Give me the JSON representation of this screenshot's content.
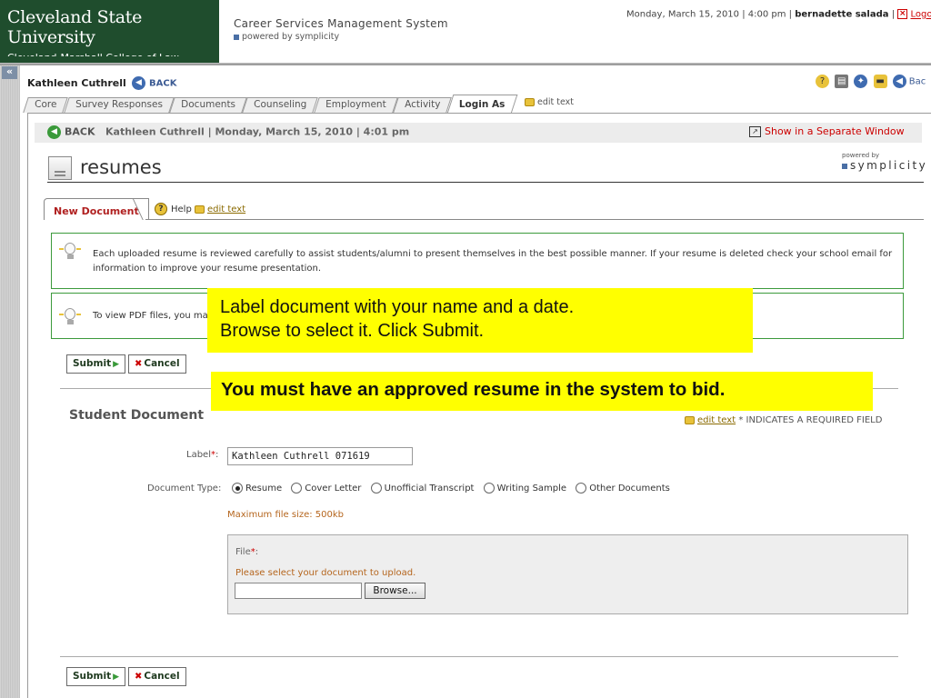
{
  "header": {
    "university": "Cleveland State University",
    "college": "Cleveland-Marshall College of Law",
    "system_title": "Career Services Management System",
    "powered_by": "powered by symplicity",
    "datetime": "Monday, March 15, 2010 | 4:00 pm |",
    "user": "bernadette salada",
    "separator": "|",
    "logout": "Logo"
  },
  "student_bar": {
    "name": "Kathleen Cuthrell",
    "back": "BACK",
    "right_back": "Bac"
  },
  "tabs": [
    {
      "label": "Core"
    },
    {
      "label": "Survey Responses"
    },
    {
      "label": "Documents"
    },
    {
      "label": "Counseling"
    },
    {
      "label": "Employment"
    },
    {
      "label": "Activity"
    },
    {
      "label": "Login As"
    }
  ],
  "tab_edit_text": "edit text",
  "inner": {
    "back": "BACK",
    "info": "Kathleen Cuthrell | Monday, March 15, 2010 | 4:01 pm",
    "separate_window": "Show in a Separate Window",
    "page_title": "resumes",
    "powered_by_small": "powered by",
    "symplicity": "symplicity"
  },
  "subtabs": {
    "new_document": "New Document",
    "help": "Help",
    "edit_text": "edit text"
  },
  "info_boxes": {
    "box1": "Each uploaded resume is reviewed carefully to assist students/alumni to present themselves in the best possible manner. If your resume is deleted check your school email for information to improve your resume presentation.",
    "box2": "To view PDF files, you ma"
  },
  "buttons": {
    "submit": "Submit",
    "cancel": "Cancel"
  },
  "form": {
    "section_title": "Student Document",
    "edit_text": "edit text",
    "required_note": "* INDICATES A REQUIRED FIELD",
    "label_label": "Label",
    "label_value": "Kathleen Cuthrell 071619",
    "doctype_label": "Document Type:",
    "doctype_options": [
      {
        "label": "Resume",
        "selected": true
      },
      {
        "label": "Cover Letter",
        "selected": false
      },
      {
        "label": "Unofficial Transcript",
        "selected": false
      },
      {
        "label": "Writing Sample",
        "selected": false
      },
      {
        "label": "Other Documents",
        "selected": false
      }
    ],
    "max_size": "Maximum file size: 500kb",
    "file_label": "File",
    "file_help": "Please select your document to upload.",
    "browse": "Browse..."
  },
  "callouts": {
    "line1": "Label document with your name and a date.",
    "line2": "Browse to select it. Click Submit.",
    "emphasis": "You must have an approved resume in the system to bid."
  },
  "colors": {
    "brand_green": "#1f4d2d",
    "highlight_yellow": "#ffff00",
    "info_border_green": "#3c9a3c",
    "link_blue": "#3b5a93",
    "alert_red": "#cc0000"
  }
}
